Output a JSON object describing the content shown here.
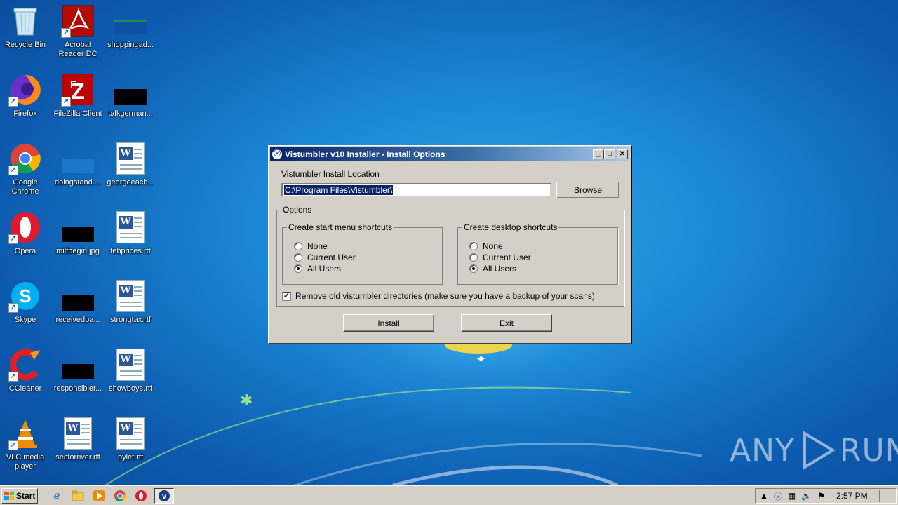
{
  "desktop": {
    "icons": [
      {
        "label": "Recycle Bin",
        "icon": "recycle-bin-icon"
      },
      {
        "label": "Acrobat Reader DC",
        "icon": "acrobat-icon"
      },
      {
        "label": "shoppingad...",
        "icon": "image-file-icon"
      },
      {
        "label": "Firefox",
        "icon": "firefox-icon"
      },
      {
        "label": "FileZilla Client",
        "icon": "filezilla-icon"
      },
      {
        "label": "talkgerman...",
        "icon": "image-file-icon"
      },
      {
        "label": "Google Chrome",
        "icon": "chrome-icon"
      },
      {
        "label": "doingstand....",
        "icon": "image-file-icon"
      },
      {
        "label": "georgeeach...",
        "icon": "word-doc-icon"
      },
      {
        "label": "Opera",
        "icon": "opera-icon"
      },
      {
        "label": "milfbegin.jpg",
        "icon": "image-file-icon"
      },
      {
        "label": "febprices.rtf",
        "icon": "word-doc-icon"
      },
      {
        "label": "Skype",
        "icon": "skype-icon"
      },
      {
        "label": "receivedpa...",
        "icon": "image-file-icon"
      },
      {
        "label": "strongtax.rtf",
        "icon": "word-doc-icon"
      },
      {
        "label": "CCleaner",
        "icon": "ccleaner-icon"
      },
      {
        "label": "responsibler...",
        "icon": "image-file-icon"
      },
      {
        "label": "showboys.rtf",
        "icon": "word-doc-icon"
      },
      {
        "label": "VLC media player",
        "icon": "vlc-icon"
      },
      {
        "label": "sectorriver.rtf",
        "icon": "word-doc-icon"
      },
      {
        "label": "bylet.rtf",
        "icon": "word-doc-icon"
      }
    ]
  },
  "dialog": {
    "title": "Vistumbler v10 Installer - Install Options",
    "title_buttons": {
      "minimize": "_",
      "maximize": "□",
      "close": "✕"
    },
    "location_label": "Vistumbler Install Location",
    "location_value": "C:\\Program Files\\Vistumbler\\",
    "browse_label": "Browse",
    "options_label": "Options",
    "start_menu": {
      "title": "Create start menu shortcuts",
      "options": [
        "None",
        "Current User",
        "All Users"
      ],
      "selected": "All Users"
    },
    "desktop_shortcuts": {
      "title": "Create desktop shortcuts",
      "options": [
        "None",
        "Current User",
        "All Users"
      ],
      "selected": "All Users"
    },
    "remove_old": {
      "label": "Remove old vistumbler directories (make sure you have a backup of your scans)",
      "checked": true
    },
    "install_label": "Install",
    "exit_label": "Exit"
  },
  "taskbar": {
    "start_label": "Start",
    "clock": "2:57 PM"
  },
  "watermark": {
    "left": "ANY",
    "right": "RUN"
  }
}
